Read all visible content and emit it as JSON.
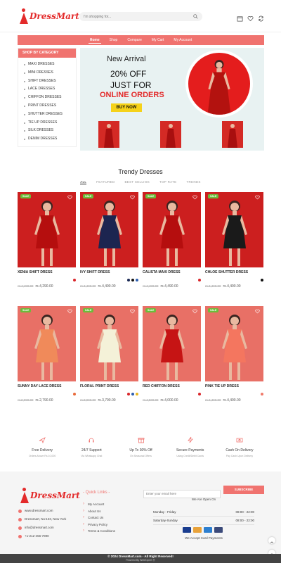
{
  "brand": {
    "name": "DressMart"
  },
  "search": {
    "placeholder": "I'm shopping for..."
  },
  "header_icons": [
    "store-icon",
    "heart-icon",
    "compare-icon"
  ],
  "nav": {
    "items": [
      "Home",
      "Shop",
      "Compare",
      "My Cart",
      "My Account"
    ],
    "active": "Home"
  },
  "sidebar": {
    "title": "SHOP BY CATEGORY",
    "items": [
      "MAXI DRESSES",
      "MINI DRESSES",
      "SHIFT DRESSES",
      "LACE DRESSES",
      "CHIFFON DRESSES",
      "PRINT DRESSES",
      "SHUTTER DRESSES",
      "TIE UP DRESSES",
      "SILK DRESSES",
      "DENIM DRESSES"
    ]
  },
  "banner": {
    "title": "New Arrival",
    "line1": "20% OFF",
    "line2": "JUST FOR",
    "line3": "ONLINE ORDERS",
    "cta": "BUY NOW"
  },
  "trendy": {
    "title": "Trendy Dresses",
    "tabs": [
      "ALL",
      "FEATURED",
      "BEST SELLING",
      "TOP RATE",
      "TRENDS"
    ],
    "active_tab": "ALL"
  },
  "products": [
    {
      "badge": "SALE",
      "name": "XENIA SHIFT DRESS",
      "old": "rs.4,490.00",
      "price": "rs.4,290.00",
      "swatches": [
        "#d9262b"
      ]
    },
    {
      "badge": "SALE",
      "name": "IVY SHIFT DRESS",
      "old": "rs.4,490.00",
      "price": "rs.4,490.00",
      "swatches": [
        "#1b2a55",
        "#111111",
        "#2f5fb0"
      ]
    },
    {
      "badge": "SALE",
      "name": "CALISTA MAXI DRESS",
      "old": "rs.4,490.00",
      "price": "rs.4,490.00",
      "swatches": [
        "#d9262b"
      ]
    },
    {
      "badge": "SALE",
      "name": "CHLOE SHUTTER DRESS",
      "old": "rs.4,490.00",
      "price": "rs.4,490.00",
      "swatches": [
        "#111111"
      ]
    },
    {
      "badge": "SALE",
      "name": "SUNNY DAY LACE DRESS",
      "old": "rs.2,990.00",
      "price": "rs.2,790.00",
      "swatches": [
        "#e86a3a"
      ]
    },
    {
      "badge": "SALE",
      "name": "FLORAL PRINT DRESS",
      "old": "rs.3,990.00",
      "price": "rs.3,790.00",
      "swatches": [
        "#d9262b",
        "#2f5fb0",
        "#e8b820"
      ]
    },
    {
      "badge": "SALE",
      "name": "RED CHIFFON DRESS",
      "old": "rs.4,500.00",
      "price": "rs.4,000.00",
      "swatches": [
        "#d9262b"
      ]
    },
    {
      "badge": "SALE",
      "name": "PINK TIE UP DRESS",
      "old": "rs.4,490.00",
      "price": "rs.4,490.00",
      "swatches": [
        "#f07a6a"
      ]
    }
  ],
  "features": [
    {
      "icon": "plane-icon",
      "title": "Free Delivery",
      "sub": "Orders Above Rs 10,000"
    },
    {
      "icon": "headset-icon",
      "title": "24/7 Support",
      "sub": "Via Whatsapp Chat"
    },
    {
      "icon": "gift-icon",
      "title": "Up To 30% Off",
      "sub": "On Seasonal Offers"
    },
    {
      "icon": "bolt-icon",
      "title": "Secure Payments",
      "sub": "Using Credit/Debit Cards"
    },
    {
      "icon": "cash-icon",
      "title": "Cash On Delivery",
      "sub": "Pay Cash Upon Delivery"
    }
  ],
  "footer": {
    "contacts": [
      "www.dressmart.com",
      "Dressmart, No:123, New York",
      "info@dressmart.com",
      "+1-212-456-7890"
    ],
    "links_title": "- Quick Links -",
    "links": [
      "My Account",
      "About Us",
      "Contact Us",
      "Privacy Policy",
      "Terms & Conditions"
    ],
    "email_placeholder": "Enter your email here",
    "subscribe": "SUBSCRIBE",
    "open_title": "We Are Open On",
    "hours": [
      {
        "day": "Monday - Friday",
        "time": "08:00 - 22:00"
      },
      {
        "day": "Saturday-Sunday",
        "time": "08:00 - 22:00"
      }
    ],
    "payment_title": "We Accept Card Payments",
    "copyright": "© 2024 DressMart.com - All Right Reserved!",
    "powered": "Powered By WebExpert Ⓡ"
  }
}
